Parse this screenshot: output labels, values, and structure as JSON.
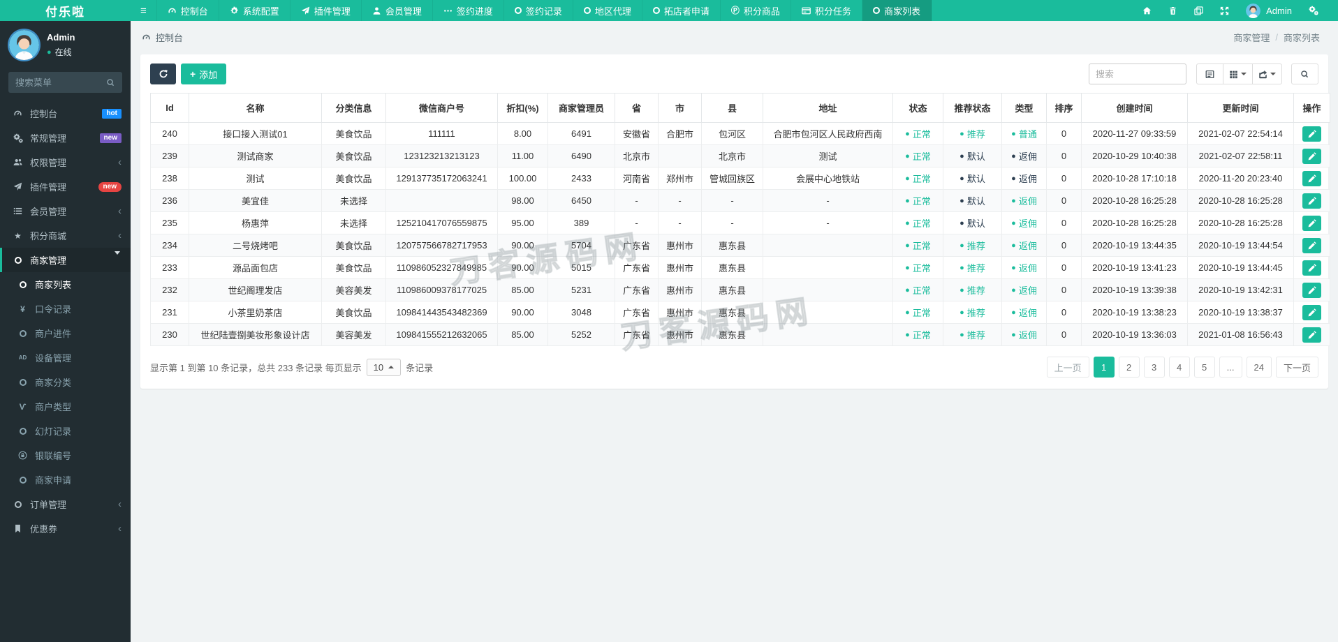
{
  "brand": "付乐啦",
  "colors": {
    "primary": "#1abc9c",
    "dark_status": "#2c3e50",
    "sidebar_bg": "#222d32",
    "badge_hot": "#1890ff",
    "badge_new_purple": "#7a5cc5",
    "badge_new_red": "#e64442"
  },
  "navbar": {
    "items": [
      {
        "label": "控制台",
        "icon": "gauge"
      },
      {
        "label": "系统配置",
        "icon": "gear"
      },
      {
        "label": "插件管理",
        "icon": "rocket"
      },
      {
        "label": "会员管理",
        "icon": "user"
      },
      {
        "label": "签约进度",
        "icon": "ellipsis"
      },
      {
        "label": "签约记录",
        "icon": "ring"
      },
      {
        "label": "地区代理",
        "icon": "ring"
      },
      {
        "label": "拓店者申请",
        "icon": "ring"
      },
      {
        "label": "积分商品",
        "icon": "pcircle"
      },
      {
        "label": "积分任务",
        "icon": "card"
      },
      {
        "label": "商家列表",
        "icon": "ring",
        "active": true
      }
    ],
    "right_icons": [
      "home",
      "trash",
      "copy",
      "expand"
    ],
    "user": {
      "name": "Admin"
    }
  },
  "sidebar": {
    "user": {
      "name": "Admin",
      "status": "在线"
    },
    "search_placeholder": "搜索菜单",
    "menu": [
      {
        "label": "控制台",
        "icon": "gauge",
        "badge": {
          "text": "hot",
          "style": "blue"
        }
      },
      {
        "label": "常规管理",
        "icon": "gears",
        "badge": {
          "text": "new",
          "style": "purple"
        }
      },
      {
        "label": "权限管理",
        "icon": "users",
        "chevron": "left"
      },
      {
        "label": "插件管理",
        "icon": "rocket",
        "badge": {
          "text": "new",
          "style": "red"
        }
      },
      {
        "label": "会员管理",
        "icon": "list",
        "chevron": "left"
      },
      {
        "label": "积分商城",
        "icon": "star",
        "chevron": "left"
      },
      {
        "label": "商家管理",
        "icon": "ring",
        "chevron": "down",
        "active": true,
        "children": [
          {
            "label": "商家列表",
            "icon": "ring",
            "active": true
          },
          {
            "label": "口令记录",
            "icon": "yen"
          },
          {
            "label": "商户进件",
            "icon": "ring"
          },
          {
            "label": "设备管理",
            "icon": "ad"
          },
          {
            "label": "商家分类",
            "icon": "ring"
          },
          {
            "label": "商户类型",
            "icon": "vine"
          },
          {
            "label": "幻灯记录",
            "icon": "ring"
          },
          {
            "label": "银联编号",
            "icon": "lock"
          },
          {
            "label": "商家申请",
            "icon": "ring"
          }
        ]
      },
      {
        "label": "订单管理",
        "icon": "ring",
        "chevron": "left"
      },
      {
        "label": "优惠券",
        "icon": "bookmark",
        "chevron": "left"
      }
    ]
  },
  "breadcrumb": {
    "section": "控制台",
    "trail": [
      "商家管理",
      "商家列表"
    ]
  },
  "toolbar": {
    "add_label": "添加",
    "search_placeholder": "搜索"
  },
  "table": {
    "columns": [
      "Id",
      "名称",
      "分类信息",
      "微信商户号",
      "折扣(%)",
      "商家管理员",
      "省",
      "市",
      "县",
      "地址",
      "状态",
      "推荐状态",
      "类型",
      "排序",
      "创建时间",
      "更新时间",
      "操作"
    ],
    "rows": [
      {
        "id": "240",
        "name": "接口接入测试01",
        "category": "美食饮品",
        "wx_mch_id": "111111",
        "discount": "8.00",
        "manager": "6491",
        "province": "安徽省",
        "city": "合肥市",
        "county": "包河区",
        "address": "合肥市包河区人民政府西南",
        "status": {
          "text": "正常",
          "on": true
        },
        "recommend": {
          "text": "推荐",
          "on": true
        },
        "type": {
          "text": "普通",
          "on": true
        },
        "sort": "0",
        "created_at": "2020-11-27 09:33:59",
        "updated_at": "2021-02-07 22:54:14"
      },
      {
        "id": "239",
        "name": "测试商家",
        "category": "美食饮品",
        "wx_mch_id": "123123213213123",
        "discount": "11.00",
        "manager": "6490",
        "province": "北京市",
        "city": "",
        "county": "北京市",
        "address": "测试",
        "status": {
          "text": "正常",
          "on": true
        },
        "recommend": {
          "text": "默认",
          "on": false
        },
        "type": {
          "text": "返佣",
          "on": false
        },
        "sort": "0",
        "created_at": "2020-10-29 10:40:38",
        "updated_at": "2021-02-07 22:58:11"
      },
      {
        "id": "238",
        "name": "测试",
        "category": "美食饮品",
        "wx_mch_id": "129137735172063241",
        "discount": "100.00",
        "manager": "2433",
        "province": "河南省",
        "city": "郑州市",
        "county": "管城回族区",
        "address": "会展中心地铁站",
        "status": {
          "text": "正常",
          "on": true
        },
        "recommend": {
          "text": "默认",
          "on": false
        },
        "type": {
          "text": "返佣",
          "on": false
        },
        "sort": "0",
        "created_at": "2020-10-28 17:10:18",
        "updated_at": "2020-11-20 20:23:40"
      },
      {
        "id": "236",
        "name": "美宜佳",
        "category": "未选择",
        "wx_mch_id": "",
        "discount": "98.00",
        "manager": "6450",
        "province": "-",
        "city": "-",
        "county": "-",
        "address": "-",
        "status": {
          "text": "正常",
          "on": true
        },
        "recommend": {
          "text": "默认",
          "on": false
        },
        "type": {
          "text": "返佣",
          "on": true
        },
        "sort": "0",
        "created_at": "2020-10-28 16:25:28",
        "updated_at": "2020-10-28 16:25:28"
      },
      {
        "id": "235",
        "name": "杨惠萍",
        "category": "未选择",
        "wx_mch_id": "125210417076559875",
        "discount": "95.00",
        "manager": "389",
        "province": "-",
        "city": "-",
        "county": "-",
        "address": "-",
        "status": {
          "text": "正常",
          "on": true
        },
        "recommend": {
          "text": "默认",
          "on": false
        },
        "type": {
          "text": "返佣",
          "on": true
        },
        "sort": "0",
        "created_at": "2020-10-28 16:25:28",
        "updated_at": "2020-10-28 16:25:28"
      },
      {
        "id": "234",
        "name": "二号烧烤吧",
        "category": "美食饮品",
        "wx_mch_id": "120757566782717953",
        "discount": "90.00",
        "manager": "5704",
        "province": "广东省",
        "city": "惠州市",
        "county": "惠东县",
        "address": "",
        "status": {
          "text": "正常",
          "on": true
        },
        "recommend": {
          "text": "推荐",
          "on": true
        },
        "type": {
          "text": "返佣",
          "on": true
        },
        "sort": "0",
        "created_at": "2020-10-19 13:44:35",
        "updated_at": "2020-10-19 13:44:54"
      },
      {
        "id": "233",
        "name": "源品面包店",
        "category": "美食饮品",
        "wx_mch_id": "110986052327849985",
        "discount": "90.00",
        "manager": "5015",
        "province": "广东省",
        "city": "惠州市",
        "county": "惠东县",
        "address": "",
        "status": {
          "text": "正常",
          "on": true
        },
        "recommend": {
          "text": "推荐",
          "on": true
        },
        "type": {
          "text": "返佣",
          "on": true
        },
        "sort": "0",
        "created_at": "2020-10-19 13:41:23",
        "updated_at": "2020-10-19 13:44:45"
      },
      {
        "id": "232",
        "name": "世纪阁理发店",
        "category": "美容美发",
        "wx_mch_id": "110986009378177025",
        "discount": "85.00",
        "manager": "5231",
        "province": "广东省",
        "city": "惠州市",
        "county": "惠东县",
        "address": "",
        "status": {
          "text": "正常",
          "on": true
        },
        "recommend": {
          "text": "推荐",
          "on": true
        },
        "type": {
          "text": "返佣",
          "on": true
        },
        "sort": "0",
        "created_at": "2020-10-19 13:39:38",
        "updated_at": "2020-10-19 13:42:31"
      },
      {
        "id": "231",
        "name": "小茶里奶茶店",
        "category": "美食饮品",
        "wx_mch_id": "109841443543482369",
        "discount": "90.00",
        "manager": "3048",
        "province": "广东省",
        "city": "惠州市",
        "county": "惠东县",
        "address": "",
        "status": {
          "text": "正常",
          "on": true
        },
        "recommend": {
          "text": "推荐",
          "on": true
        },
        "type": {
          "text": "返佣",
          "on": true
        },
        "sort": "0",
        "created_at": "2020-10-19 13:38:23",
        "updated_at": "2020-10-19 13:38:37"
      },
      {
        "id": "230",
        "name": "世纪陆壹捌美妆形象设计店",
        "category": "美容美发",
        "wx_mch_id": "109841555212632065",
        "discount": "85.00",
        "manager": "5252",
        "province": "广东省",
        "city": "惠州市",
        "county": "惠东县",
        "address": "",
        "status": {
          "text": "正常",
          "on": true
        },
        "recommend": {
          "text": "推荐",
          "on": true
        },
        "type": {
          "text": "返佣",
          "on": true
        },
        "sort": "0",
        "created_at": "2020-10-19 13:36:03",
        "updated_at": "2021-01-08 16:56:43"
      }
    ]
  },
  "pagination": {
    "summary_prefix": "显示第 1 到第 10 条记录，总共 233 条记录 每页显示",
    "page_size": "10",
    "summary_suffix": "条记录",
    "pages": [
      {
        "label": "上一页",
        "muted": true
      },
      {
        "label": "1",
        "active": true
      },
      {
        "label": "2"
      },
      {
        "label": "3"
      },
      {
        "label": "4"
      },
      {
        "label": "5"
      },
      {
        "label": "..."
      },
      {
        "label": "24"
      },
      {
        "label": "下一页"
      }
    ]
  },
  "watermark": "刀客源码网"
}
